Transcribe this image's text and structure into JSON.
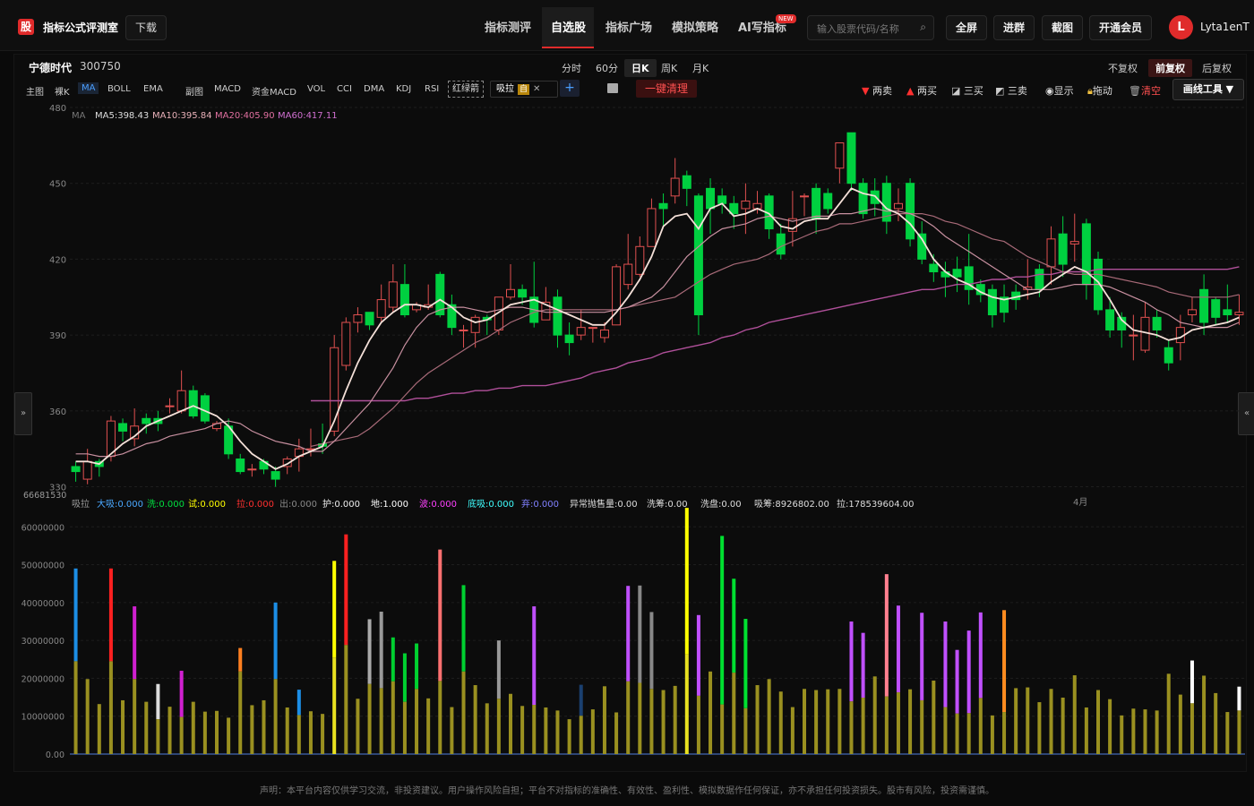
{
  "app": {
    "logo": "股",
    "title": "指标公式评测室",
    "download": "下载"
  },
  "nav": {
    "items": [
      "指标测评",
      "自选股",
      "指标广场",
      "模拟策略",
      "AI写指标"
    ],
    "active": "自选股",
    "new_badge": "NEW"
  },
  "search": {
    "placeholder": "输入股票代码/名称"
  },
  "top_buttons": {
    "fullscreen": "全屏",
    "join_group": "进群",
    "screenshot": "截图",
    "vip": "开通会员"
  },
  "user": {
    "initial": "L",
    "name": "Lyta1enT"
  },
  "stock": {
    "name": "宁德时代",
    "code": "300750"
  },
  "periods": {
    "items": [
      "分时",
      "60分",
      "日K",
      "周K",
      "月K"
    ],
    "active": "日K"
  },
  "adjust": {
    "items": [
      "不复权",
      "前复权",
      "后复权"
    ],
    "active": "前复权"
  },
  "indicator_tools": {
    "items": [
      "主图",
      "裸K",
      "MA",
      "BOLL",
      "EMA",
      "副图",
      "MACD",
      "资金MACD",
      "VOL",
      "CCI",
      "DMA",
      "KDJ",
      "RSI"
    ],
    "active": "MA",
    "red_green": "红绿箭",
    "xila": "吸拉",
    "zi": "自",
    "clear": "一键清理"
  },
  "right_tools": {
    "sell2": "两卖",
    "buy2": "两买",
    "buy3": "三买",
    "sell3": "三卖",
    "show": "显示",
    "drag": "拖动",
    "empty": "清空",
    "draw": "画线工具 ▼"
  },
  "side": {
    "left": "»",
    "right": "«"
  },
  "ma_legend": {
    "label": "MA",
    "ma5": "MA5:398.43",
    "ma10": "MA10:395.84",
    "ma20": "MA20:405.90",
    "ma60": "MA60:417.11"
  },
  "sub_legend": {
    "label": "吸拉",
    "items": [
      "大吸:0.000",
      "洗:0.000",
      "试:0.000",
      "拉:0.000",
      "出:0.000",
      "护:0.000",
      "地:1.000",
      "波:0.000",
      "底吸:0.000",
      "弃:0.000",
      "异常抛售量:0.00",
      "洗筹:0.00",
      "洗盘:0.00",
      "吸筹:8926802.00",
      "拉:178539604.00"
    ],
    "colors": [
      "#4aa8ff",
      "#00e040",
      "#ffff00",
      "#ff3030",
      "#888888",
      "#eeeeee",
      "#ffffff",
      "#ff40ff",
      "#40ffff",
      "#8080ff",
      "#dddddd",
      "#dddddd",
      "#dddddd",
      "#dddddd",
      "#dddddd"
    ]
  },
  "price_axis": {
    "ticks": [
      480,
      450,
      420,
      390,
      360,
      330
    ],
    "min": 327,
    "max": 480
  },
  "vol_axis": {
    "top_label": "66681530",
    "ticks": [
      "60000000",
      "50000000",
      "40000000",
      "30000000",
      "20000000",
      "10000000",
      "0.00"
    ],
    "max": 66681530
  },
  "x_axis": {
    "labels": [
      "4月"
    ]
  },
  "chart_data": {
    "type": "candlestick",
    "ohlc": [
      [
        338,
        336,
        332,
        340
      ],
      [
        333,
        340,
        331,
        345
      ],
      [
        340,
        338,
        334,
        341
      ],
      [
        342,
        356,
        340,
        358
      ],
      [
        355,
        352,
        348,
        357
      ],
      [
        349,
        354,
        346,
        361
      ],
      [
        357,
        355,
        351,
        359
      ],
      [
        357,
        355,
        352,
        360
      ],
      [
        362,
        362,
        359,
        365
      ],
      [
        360,
        368,
        359,
        376
      ],
      [
        368,
        358,
        357,
        370
      ],
      [
        366,
        356,
        355,
        367
      ],
      [
        353,
        355,
        352,
        356
      ],
      [
        354,
        343,
        341,
        357
      ],
      [
        341,
        336,
        335,
        343
      ],
      [
        337,
        337,
        334,
        339
      ],
      [
        340,
        337,
        335,
        341
      ],
      [
        336,
        333,
        330,
        338
      ],
      [
        338,
        341,
        335,
        342
      ],
      [
        342,
        345,
        336,
        349
      ],
      [
        345,
        345,
        342,
        353
      ],
      [
        347,
        346,
        343,
        355
      ],
      [
        352,
        385,
        350,
        390
      ],
      [
        378,
        395,
        376,
        397
      ],
      [
        395,
        398,
        391,
        401
      ],
      [
        399,
        394,
        392,
        399
      ],
      [
        397,
        404,
        395,
        410
      ],
      [
        401,
        411,
        399,
        418
      ],
      [
        410,
        398,
        397,
        418
      ],
      [
        400,
        402,
        399,
        403
      ],
      [
        401,
        402,
        400,
        410
      ],
      [
        414,
        398,
        397,
        415
      ],
      [
        402,
        393,
        390,
        406
      ],
      [
        392,
        392,
        385,
        394
      ],
      [
        391,
        397,
        385,
        398
      ],
      [
        397,
        396,
        390,
        398
      ],
      [
        392,
        405,
        390,
        405
      ],
      [
        405,
        408,
        404,
        418
      ],
      [
        408,
        405,
        402,
        410
      ],
      [
        405,
        395,
        393,
        419
      ],
      [
        396,
        403,
        398,
        409
      ],
      [
        405,
        390,
        385,
        408
      ],
      [
        390,
        387,
        382,
        395
      ],
      [
        390,
        393,
        388,
        400
      ],
      [
        393,
        393,
        387,
        393
      ],
      [
        389,
        392,
        387,
        395
      ],
      [
        394,
        417,
        394,
        418
      ],
      [
        410,
        418,
        408,
        430
      ],
      [
        414,
        425,
        413,
        429
      ],
      [
        425,
        440,
        425,
        444
      ],
      [
        442,
        440,
        433,
        446
      ],
      [
        445,
        452,
        442,
        460
      ],
      [
        453,
        448,
        441,
        455
      ],
      [
        445,
        398,
        390,
        446
      ],
      [
        448,
        440,
        430,
        452
      ],
      [
        445,
        442,
        438,
        448
      ],
      [
        442,
        438,
        432,
        445
      ],
      [
        440,
        443,
        430,
        450
      ],
      [
        440,
        442,
        438,
        447
      ],
      [
        445,
        432,
        428,
        446
      ],
      [
        430,
        422,
        420,
        434
      ],
      [
        431,
        436,
        425,
        447
      ],
      [
        445,
        445,
        437,
        446
      ],
      [
        448,
        436,
        430,
        450
      ],
      [
        446,
        440,
        438,
        448
      ],
      [
        456,
        466,
        450,
        465
      ],
      [
        470,
        450,
        447,
        470
      ],
      [
        450,
        438,
        436,
        452
      ],
      [
        447,
        442,
        437,
        452
      ],
      [
        450,
        435,
        430,
        453
      ],
      [
        440,
        442,
        435,
        448
      ],
      [
        450,
        428,
        425,
        452
      ],
      [
        430,
        420,
        418,
        435
      ],
      [
        418,
        415,
        411,
        422
      ],
      [
        415,
        413,
        405,
        419
      ],
      [
        416,
        413,
        407,
        421
      ],
      [
        417,
        408,
        402,
        430
      ],
      [
        410,
        406,
        403,
        412
      ],
      [
        408,
        398,
        393,
        410
      ],
      [
        405,
        399,
        395,
        410
      ],
      [
        407,
        404,
        400,
        410
      ],
      [
        408,
        409,
        404,
        420
      ],
      [
        416,
        408,
        405,
        418
      ],
      [
        417,
        428,
        410,
        433
      ],
      [
        430,
        418,
        413,
        437
      ],
      [
        426,
        427,
        419,
        438
      ],
      [
        434,
        410,
        404,
        436
      ],
      [
        420,
        400,
        398,
        423
      ],
      [
        400,
        392,
        389,
        405
      ],
      [
        397,
        392,
        385,
        399
      ],
      [
        390,
        390,
        380,
        398
      ],
      [
        384,
        397,
        383,
        403
      ],
      [
        397,
        392,
        389,
        400
      ],
      [
        385,
        379,
        376,
        388
      ],
      [
        387,
        393,
        380,
        398
      ],
      [
        398,
        400,
        395,
        405
      ],
      [
        408,
        395,
        390,
        414
      ],
      [
        404,
        397,
        394,
        405
      ],
      [
        400,
        398,
        395,
        410
      ],
      [
        398,
        399,
        394,
        406
      ]
    ],
    "ma5": [
      340,
      340,
      339,
      343,
      347,
      350,
      354,
      356,
      358,
      360,
      362,
      360,
      358,
      354,
      348,
      343,
      340,
      337,
      339,
      342,
      344,
      346,
      356,
      368,
      379,
      388,
      395,
      399,
      402,
      402,
      401,
      404,
      401,
      397,
      395,
      396,
      399,
      402,
      403,
      404,
      402,
      400,
      398,
      396,
      394,
      394,
      399,
      405,
      412,
      421,
      433,
      437,
      438,
      432,
      440,
      442,
      437,
      438,
      440,
      438,
      433,
      432,
      435,
      436,
      436,
      442,
      448,
      446,
      445,
      440,
      438,
      434,
      428,
      420,
      415,
      412,
      410,
      407,
      405,
      404,
      405,
      406,
      407,
      411,
      414,
      417,
      415,
      411,
      404,
      396,
      392,
      391,
      390,
      388,
      389,
      392,
      393,
      394,
      395,
      397
    ],
    "ma10": [
      343,
      343,
      342,
      342,
      343,
      345,
      347,
      348,
      350,
      351,
      352,
      353,
      355,
      356,
      355,
      352,
      350,
      348,
      347,
      346,
      344,
      344,
      348,
      353,
      358,
      363,
      370,
      377,
      386,
      393,
      398,
      400,
      401,
      401,
      400,
      399,
      400,
      401,
      401,
      400,
      399,
      399,
      399,
      399,
      399,
      399,
      400,
      401,
      403,
      405,
      409,
      415,
      421,
      425,
      429,
      432,
      433,
      434,
      436,
      437,
      436,
      435,
      436,
      437,
      437,
      438,
      438,
      439,
      440,
      439,
      439,
      438,
      436,
      433,
      429,
      426,
      423,
      420,
      417,
      414,
      411,
      408,
      408,
      408,
      409,
      410,
      410,
      410,
      409,
      407,
      405,
      403,
      400,
      398,
      395,
      394,
      393,
      393,
      393,
      395
    ],
    "ma20": [
      null,
      null,
      null,
      null,
      null,
      null,
      null,
      null,
      null,
      null,
      null,
      null,
      null,
      null,
      null,
      null,
      null,
      null,
      null,
      null,
      346,
      347,
      348,
      349,
      350,
      353,
      357,
      361,
      366,
      371,
      375,
      378,
      381,
      384,
      387,
      389,
      392,
      395,
      397,
      399,
      400,
      400,
      400,
      400,
      400,
      400,
      400,
      401,
      402,
      403,
      404,
      405,
      408,
      411,
      414,
      416,
      418,
      419,
      420,
      422,
      425,
      427,
      429,
      431,
      432,
      434,
      434,
      435,
      436,
      437,
      438,
      438,
      438,
      437,
      435,
      434,
      432,
      430,
      428,
      427,
      424,
      421,
      419,
      417,
      415,
      414,
      414,
      414,
      413,
      412,
      411,
      410,
      409,
      407,
      406,
      405,
      405,
      405,
      405,
      406
    ],
    "ma60": [
      null,
      null,
      null,
      null,
      null,
      null,
      null,
      null,
      null,
      null,
      null,
      null,
      null,
      null,
      null,
      null,
      null,
      null,
      null,
      null,
      364,
      364,
      364,
      364,
      364,
      364,
      364,
      364,
      364,
      365,
      365,
      366,
      367,
      367,
      368,
      368,
      369,
      369,
      370,
      370,
      370,
      371,
      372,
      373,
      375,
      376,
      377,
      379,
      380,
      381,
      383,
      384,
      385,
      386,
      387,
      389,
      390,
      392,
      393,
      395,
      396,
      397,
      398,
      399,
      400,
      401,
      402,
      403,
      404,
      405,
      406,
      407,
      408,
      408,
      409,
      410,
      410,
      411,
      412,
      412,
      413,
      413,
      414,
      414,
      415,
      415,
      415,
      416,
      416,
      416,
      416,
      416,
      416,
      416,
      416,
      416,
      416,
      416,
      416,
      417
    ],
    "volume": [
      24500000,
      19800000,
      13200000,
      24500000,
      14200000,
      19800000,
      13800000,
      9200000,
      12500000,
      9800000,
      13800000,
      11200000,
      11400000,
      9600000,
      21800000,
      12900000,
      14200000,
      19800000,
      12300000,
      10300000,
      11300000,
      10600000,
      25500000,
      28800000,
      14600000,
      18500000,
      17400000,
      19200000,
      13800000,
      17200000,
      14700000,
      19300000,
      12400000,
      21800000,
      18200000,
      13400000,
      14600000,
      15900000,
      12700000,
      13000000,
      12300000,
      11500000,
      9200000,
      10100000,
      11800000,
      17900000,
      11000000,
      19200000,
      18800000,
      17200000,
      16900000,
      18000000,
      26300000,
      15400000,
      21800000,
      13100000,
      21500000,
      12100000,
      18200000,
      19800000,
      16500000,
      12400000,
      17200000,
      16900000,
      17100000,
      17200000,
      13900000,
      14900000,
      20500000,
      15200000,
      16300000,
      17100000,
      14200000,
      19400000,
      12400000,
      10700000,
      10800000,
      14800000,
      10200000,
      11100000,
      17400000,
      17600000,
      13700000,
      17200000,
      14900000,
      20800000,
      12300000,
      16900000,
      14500000,
      10200000,
      12000000,
      11800000,
      11500000,
      21200000,
      15700000,
      13400000,
      20700000,
      16100000,
      11100000,
      11500000
    ],
    "signal": [
      49000000,
      0,
      0,
      49000000,
      0,
      39000000,
      0,
      18500000,
      0,
      22000000,
      0,
      0,
      0,
      0,
      28000000,
      0,
      0,
      40000000,
      0,
      17000000,
      0,
      0,
      51000000,
      58000000,
      0,
      35600000,
      37600000,
      30800000,
      26600000,
      29200000,
      0,
      54000000,
      0,
      44600000,
      0,
      0,
      30000000,
      0,
      0,
      39000000,
      0,
      0,
      0,
      18300000,
      0,
      0,
      0,
      44400000,
      44500000,
      37500000,
      0,
      0,
      65000000,
      36700000,
      0,
      57600000,
      46300000,
      35700000,
      0,
      0,
      0,
      0,
      0,
      0,
      0,
      0,
      35000000,
      32000000,
      0,
      47500000,
      39200000,
      0,
      37300000,
      0,
      35000000,
      27500000,
      32600000,
      37400000,
      0,
      38000000,
      0,
      0,
      0,
      0,
      0,
      0,
      0,
      0,
      0,
      0,
      0,
      0,
      0,
      0,
      0,
      24700000,
      0,
      0,
      0,
      17800000
    ],
    "signal_colors": [
      "#1c8ee6",
      "",
      "",
      "#ff2020",
      "",
      "#d020d0",
      "",
      "#dddddd",
      "",
      "#d020d0",
      "",
      "",
      "",
      "",
      "#ff7f20",
      "",
      "",
      "#1c8ee6",
      "",
      "#1c8ee6",
      "",
      "",
      "#ffff00",
      "#ff2020",
      "",
      "#aaaaaa",
      "#999999",
      "#00d030",
      "#00d030",
      "#00d030",
      "",
      "#ff7070",
      "",
      "#00d030",
      "",
      "",
      "#999999",
      "",
      "",
      "#c050ff",
      "",
      "",
      "",
      "#1a4070",
      "",
      "",
      "",
      "#c050ff",
      "#888888",
      "#888888",
      "",
      "",
      "#ffff00",
      "#c050ff",
      "",
      "#00e030",
      "#00e030",
      "#00e030",
      "",
      "",
      "",
      "",
      "",
      "",
      "",
      "",
      "#c050ff",
      "#c050ff",
      "",
      "#ff8090",
      "#c050ff",
      "",
      "#c050ff",
      "",
      "#c050ff",
      "#c050ff",
      "#c050ff",
      "#c050ff",
      "",
      "#ff8c20",
      "",
      "",
      "",
      "",
      "",
      "",
      "",
      "",
      "",
      "",
      "",
      "",
      "",
      "",
      "",
      "#ffffff",
      "",
      "",
      "",
      "#ffffff"
    ]
  },
  "disclaimer": "声明：本平台内容仅供学习交流，非投资建议。用户操作风险自担；平台不对指标的准确性、有效性、盈利性、模拟数据作任何保证，亦不承担任何投资损失。股市有风险，投资需谨慎。"
}
